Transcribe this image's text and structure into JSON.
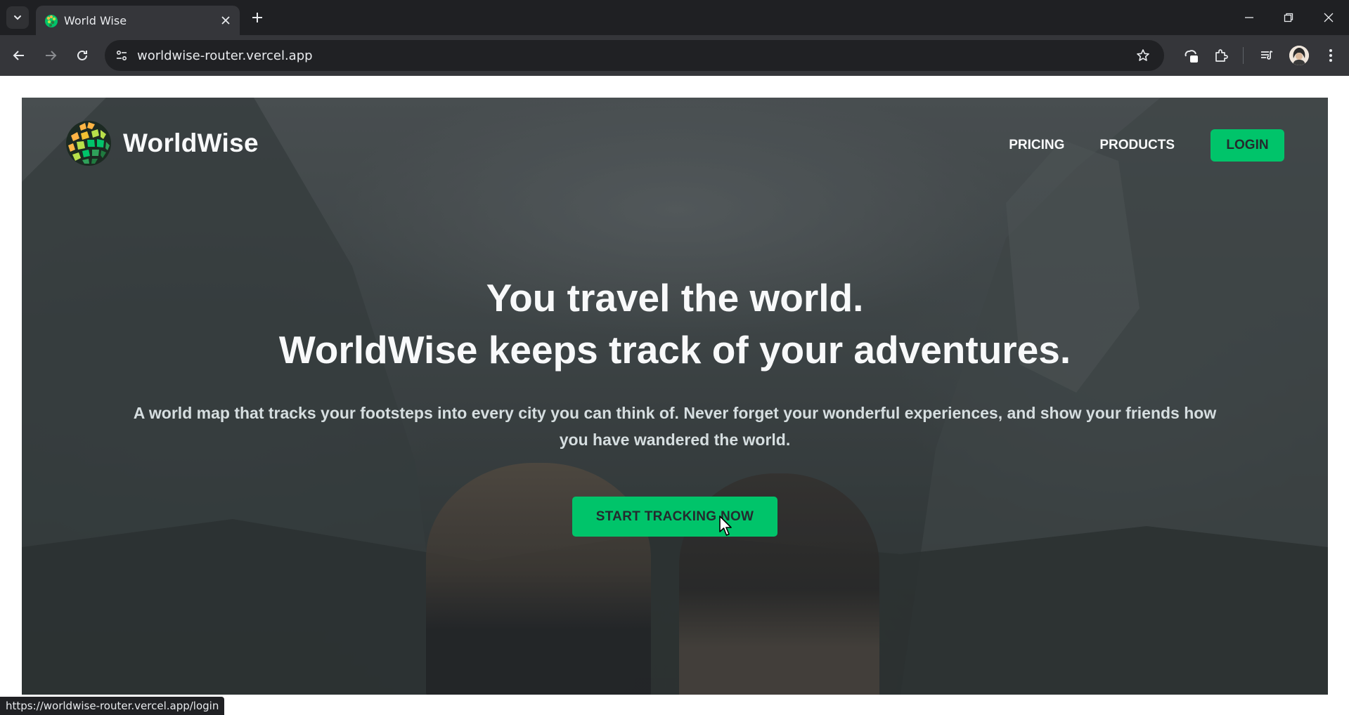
{
  "browser": {
    "tab_title": "World Wise",
    "url": "worldwise-router.vercel.app",
    "status_url": "https://worldwise-router.vercel.app/login"
  },
  "site": {
    "logo_text": "WorldWise",
    "nav": {
      "pricing": "PRICING",
      "products": "PRODUCTS",
      "login": "LOGIN"
    },
    "headline_line1": "You travel the world.",
    "headline_line2": "WorldWise keeps track of your adventures.",
    "subtitle": "A world map that tracks your footsteps into every city you can think of. Never forget your wonderful experiences, and show your friends how you have wandered the world.",
    "cta": "START TRACKING NOW"
  },
  "colors": {
    "brand_green": "#00c46a",
    "brand_yellow": "#ffb545",
    "dark_text": "#242a2e",
    "light_text": "#f8f9fa",
    "chrome_bg": "#1f2023",
    "toolbar_bg": "#35363a"
  },
  "icons": {
    "tab_menu": "chevron-down-icon",
    "close": "close-icon",
    "new_tab": "plus-icon",
    "back": "arrow-left-icon",
    "forward": "arrow-right-icon",
    "reload": "reload-icon",
    "site_settings": "tune-icon",
    "bookmark": "star-icon",
    "extensions": "puzzle-icon",
    "media": "media-queue-icon",
    "menu": "kebab-icon"
  }
}
